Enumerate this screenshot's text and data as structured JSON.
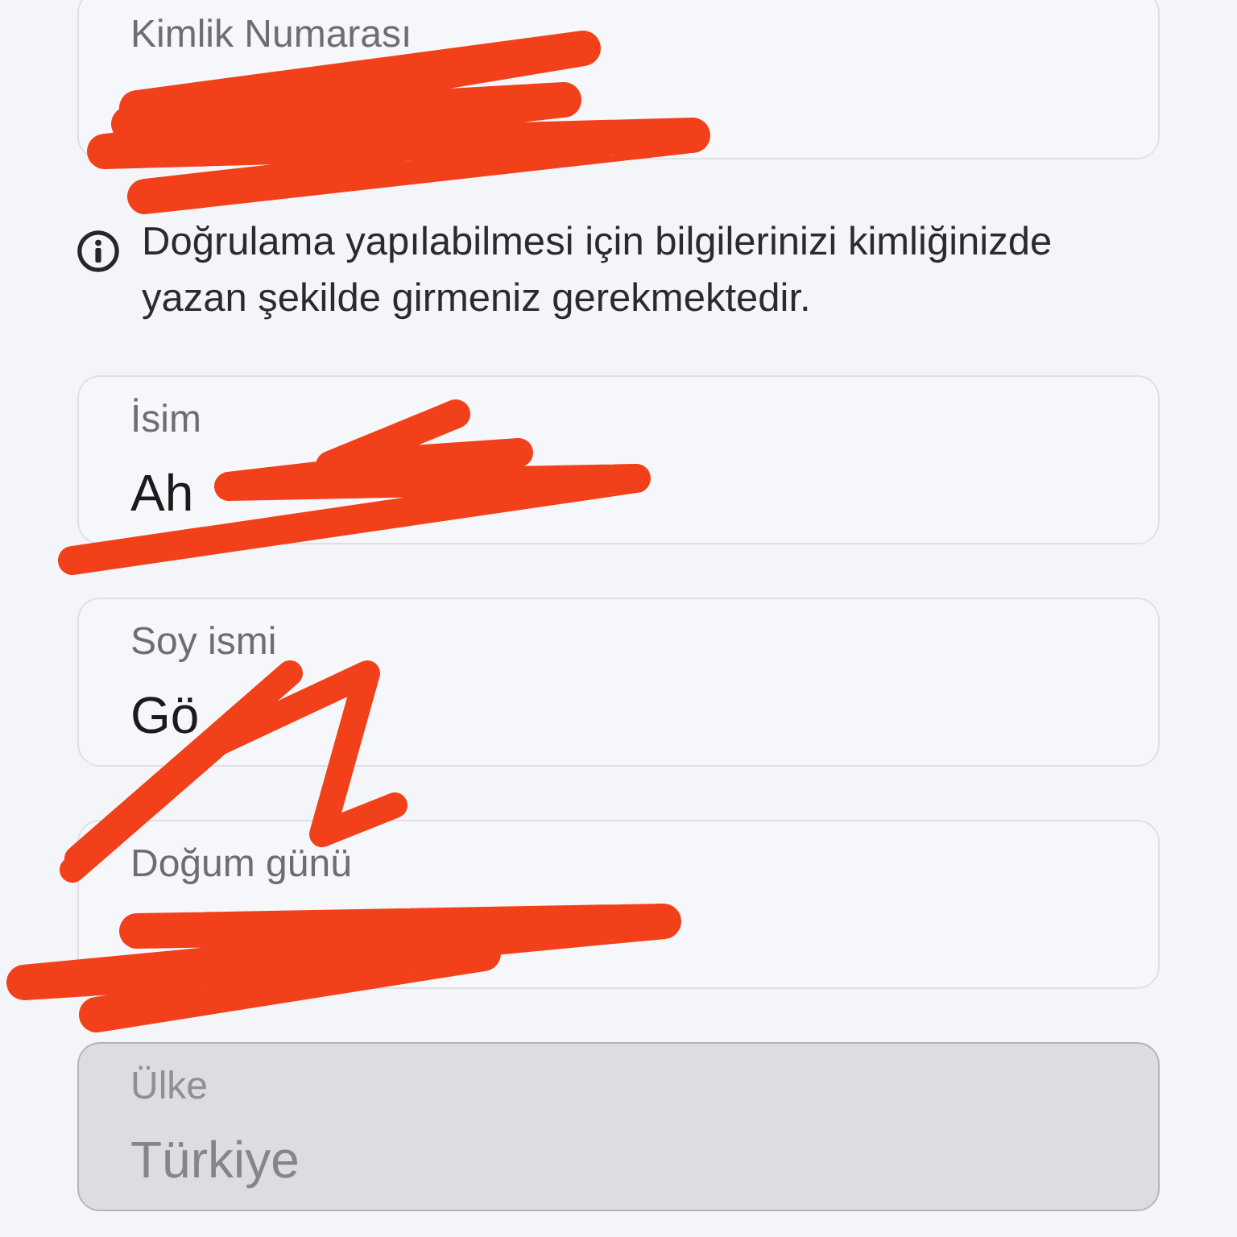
{
  "id_field": {
    "label": "Kimlik Numarası",
    "redacted": true,
    "disabled": false
  },
  "notice": {
    "text": "Doğrulama yapılabilmesi için bilgilerinizi kimliğinizde yazan şekilde girmeniz gerekmektedir."
  },
  "fields": [
    {
      "label": "İsim",
      "value": "Ah",
      "redacted": true,
      "disabled": false
    },
    {
      "label": "Soy ismi",
      "value": "Gö",
      "redacted": true,
      "disabled": false
    },
    {
      "label": "Doğum günü",
      "redacted": true,
      "disabled": false
    },
    {
      "label": "Ülke",
      "value": "Türkiye",
      "redacted": false,
      "disabled": true
    }
  ]
}
